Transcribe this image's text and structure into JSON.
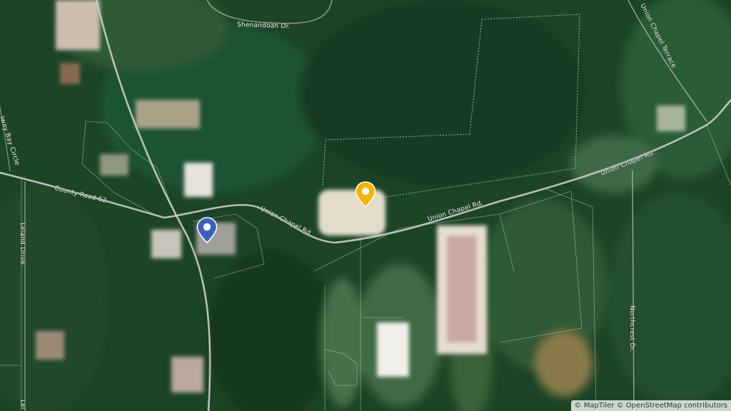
{
  "map": {
    "basemap": "satellite",
    "roads": [
      {
        "name": "County Road 62"
      },
      {
        "name": "Union Chapel Rd."
      },
      {
        "name": "Shenandoah Dr."
      },
      {
        "name": "Union Chapel Terrace"
      },
      {
        "name": "Northcrest Dr."
      },
      {
        "name": "Leland Drive"
      },
      {
        "name": "Galway Bay Circle"
      }
    ],
    "road_labels": {
      "county_road_62": "County Road 62",
      "union_chapel_west": "Union Chapel Rd.",
      "union_chapel_mid": "Union Chapel Rd.",
      "union_chapel_east": "Union Chapel Rd.",
      "shenandoah": "Shenandoah Dr.",
      "union_chapel_terrace": "Union Chapel Terrace",
      "northcrest": "Northcrest Dr.",
      "leland": "Leland Drive",
      "leland_bottom": "Lel",
      "galway": "lway Bay Circle"
    },
    "markers": [
      {
        "id": "blue",
        "color": "#3b5fbf",
        "icon": "map-pin-icon"
      },
      {
        "id": "yellow",
        "color": "#f5b400",
        "icon": "map-pin-icon"
      }
    ],
    "attribution": {
      "maptiler": "© MapTiler",
      "osm": "© OpenStreetMap contributors"
    }
  }
}
